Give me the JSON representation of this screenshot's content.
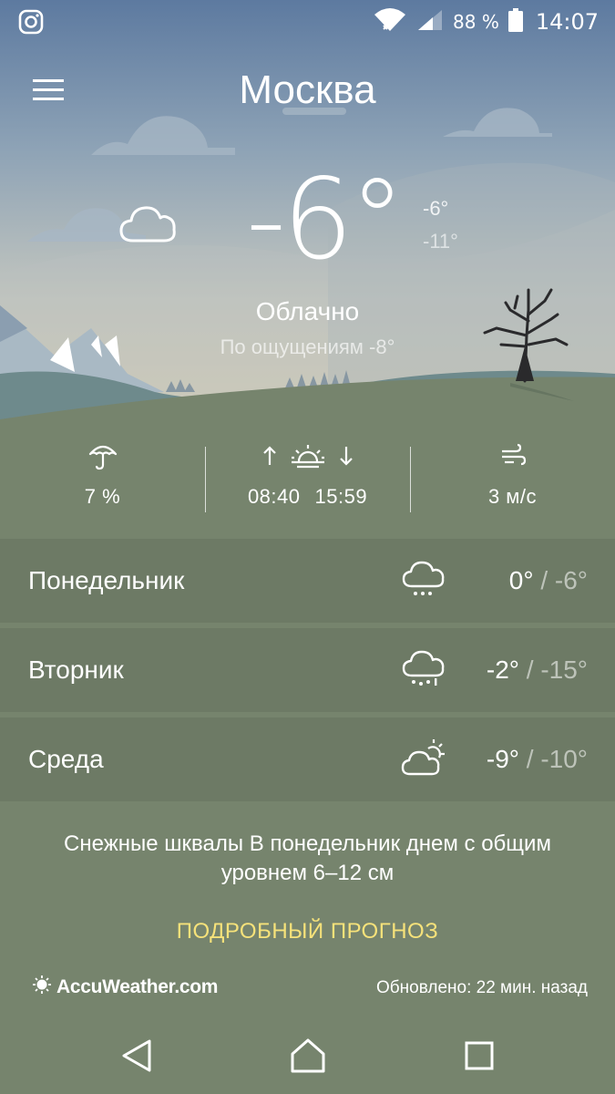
{
  "status_bar": {
    "left_icon": "instagram-icon",
    "wifi_icon": "wifi-icon",
    "signal_icon": "cell-signal-icon",
    "battery_percent": "88 %",
    "battery_icon": "battery-icon",
    "time": "14:07"
  },
  "header": {
    "menu_icon": "hamburger-menu-icon",
    "city": "Москва"
  },
  "current": {
    "icon": "cloud-icon",
    "temperature": "-6°",
    "high": "-6°",
    "low": "-11°",
    "condition": "Облачно",
    "feels_like": "По ощущениям -8°"
  },
  "stats": {
    "precipitation": {
      "icon": "umbrella-icon",
      "value": "7 %"
    },
    "sun": {
      "sunrise_icon": "arrow-up-icon",
      "sun_icon": "sunrise-sunset-icon",
      "sunset_icon": "arrow-down-icon",
      "sunrise": "08:40",
      "sunset": "15:59"
    },
    "wind": {
      "icon": "wind-icon",
      "value": "3 м/с"
    }
  },
  "forecast": [
    {
      "day": "Понедельник",
      "icon": "snow-cloud-icon",
      "high": "0°",
      "sep": " / ",
      "low": "-6°"
    },
    {
      "day": "Вторник",
      "icon": "snow-cloud-icon",
      "high": "-2°",
      "sep": " / ",
      "low": "-15°"
    },
    {
      "day": "Среда",
      "icon": "partly-sunny-icon",
      "high": "-9°",
      "sep": " / ",
      "low": "-10°"
    }
  ],
  "alert": "Снежные шквалы В понедельник днем с общим уровнем 6–12 см",
  "detailed_link": "ПОДРОБНЫЙ ПРОГНОЗ",
  "footer": {
    "provider": "AccuWeather.com",
    "updated": "Обновлено: 22 мин. назад"
  },
  "nav": {
    "back_icon": "back-icon",
    "home_icon": "home-icon",
    "recents_icon": "recents-icon"
  },
  "colors": {
    "accent_link": "#f6e27a",
    "ground": "#76846d",
    "row_bg": "#6d7a65"
  }
}
